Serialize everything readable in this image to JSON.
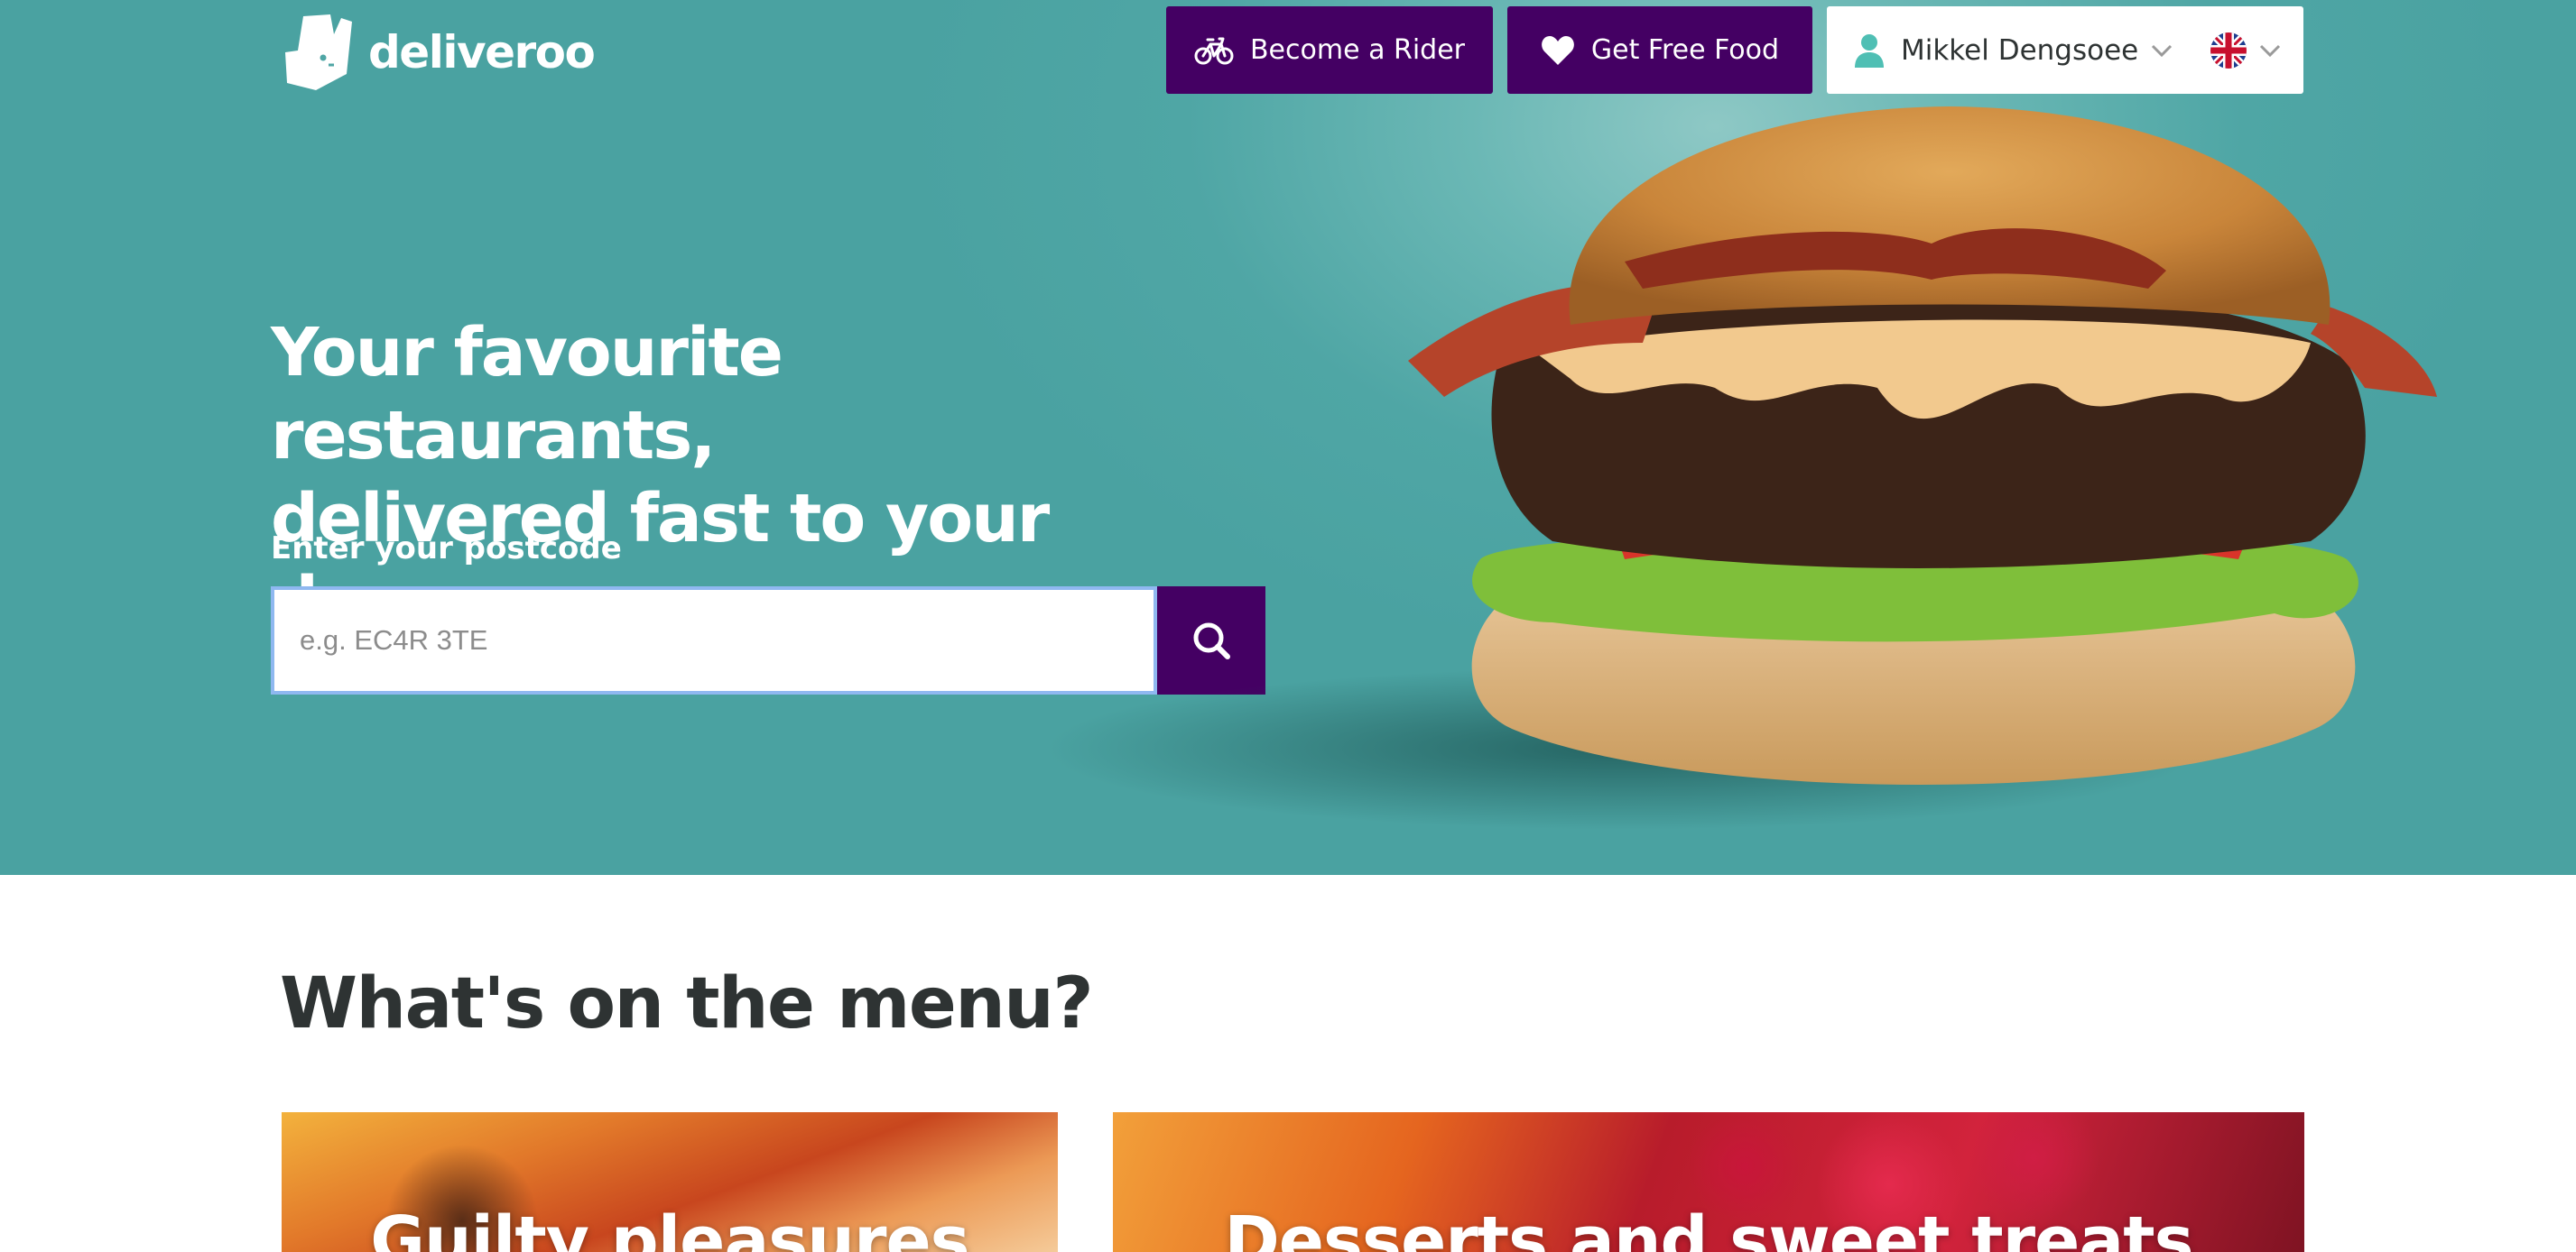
{
  "brand": {
    "name": "deliveroo"
  },
  "nav": {
    "rider_label": "Become a Rider",
    "food_label": "Get Free Food",
    "account_name": "Mikkel Dengsoee"
  },
  "hero": {
    "headline_line1": "Your favourite restaurants,",
    "headline_line2": "delivered fast to your door.",
    "postcode_label": "Enter your postcode",
    "postcode_placeholder": "e.g. EC4R 3TE",
    "postcode_value": ""
  },
  "menu": {
    "title": "What's on the menu?",
    "cards": [
      {
        "label": "Guilty pleasures"
      },
      {
        "label": "Desserts and sweet treats"
      }
    ]
  },
  "colors": {
    "hero_teal": "#4fa6a5",
    "brand_purple": "#440063",
    "account_icon": "#4fbfb4",
    "text_dark": "#2e3333"
  },
  "icons": {
    "logo": "kangaroo-logo-icon",
    "rider": "bicycle-icon",
    "food": "heart-icon",
    "account": "user-icon",
    "language": "uk-flag-icon",
    "search": "search-icon"
  }
}
